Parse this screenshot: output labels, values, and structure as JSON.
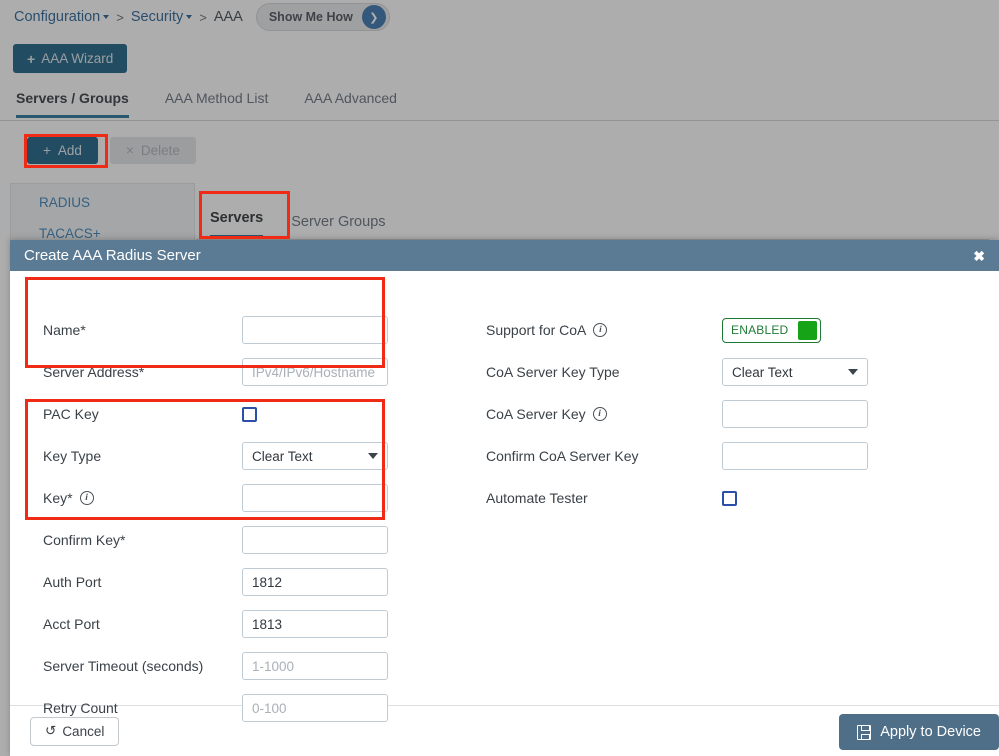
{
  "breadcrumb": {
    "items": [
      {
        "label": "Configuration",
        "has_caret": true,
        "link": true
      },
      {
        "label": "Security",
        "has_caret": true,
        "link": true
      },
      {
        "label": "AAA",
        "has_caret": false,
        "link": false
      }
    ],
    "separator": ">",
    "show_me_how": "Show Me How"
  },
  "toolbar": {
    "wizard_label": "AAA Wizard",
    "wizard_plus": "+",
    "add_label": "Add",
    "add_plus": "+",
    "delete_label": "Delete",
    "delete_x": "×"
  },
  "top_tabs": [
    {
      "label": "Servers / Groups",
      "active": true
    },
    {
      "label": "AAA Method List",
      "active": false
    },
    {
      "label": "AAA Advanced",
      "active": false
    }
  ],
  "side_panel": {
    "items": [
      {
        "label": "RADIUS"
      },
      {
        "label": "TACACS+"
      }
    ]
  },
  "inner_tabs": [
    {
      "label": "Servers",
      "active": true
    },
    {
      "label": "Server Groups",
      "active": false
    }
  ],
  "modal": {
    "title": "Create AAA Radius Server",
    "close_icon": "✖",
    "left_fields": [
      {
        "label": "Name*",
        "type": "text",
        "value": "",
        "placeholder": ""
      },
      {
        "label": "Server Address*",
        "type": "text",
        "value": "",
        "placeholder": "IPv4/IPv6/Hostname"
      },
      {
        "label": "PAC Key",
        "type": "checkbox",
        "checked": false
      },
      {
        "label": "Key Type",
        "type": "select",
        "value": "Clear Text"
      },
      {
        "label": "Key*",
        "type": "text",
        "value": "",
        "placeholder": "",
        "info": true
      },
      {
        "label": "Confirm Key*",
        "type": "text",
        "value": "",
        "placeholder": ""
      },
      {
        "label": "Auth Port",
        "type": "text",
        "value": "1812",
        "placeholder": ""
      },
      {
        "label": "Acct Port",
        "type": "text",
        "value": "1813",
        "placeholder": ""
      },
      {
        "label": "Server Timeout (seconds)",
        "type": "text",
        "value": "",
        "placeholder": "1-1000"
      },
      {
        "label": "Retry Count",
        "type": "text",
        "value": "",
        "placeholder": "0-100"
      }
    ],
    "right_fields": [
      {
        "label": "Support for CoA",
        "type": "toggle",
        "value": "ENABLED",
        "info": true
      },
      {
        "label": "CoA Server Key Type",
        "type": "select",
        "value": "Clear Text"
      },
      {
        "label": "CoA Server Key",
        "type": "text",
        "value": "",
        "placeholder": "",
        "info": true
      },
      {
        "label": "Confirm CoA Server Key",
        "type": "text",
        "value": "",
        "placeholder": ""
      },
      {
        "label": "Automate Tester",
        "type": "checkbox",
        "checked": false
      }
    ],
    "footer": {
      "cancel_label": "Cancel",
      "cancel_icon": "↺",
      "apply_label": "Apply to Device"
    }
  },
  "colors": {
    "accent_teal": "#10597f",
    "modal_header": "#5b7b95",
    "highlight_red": "#ef2b16",
    "toggle_green": "#16a317",
    "link_blue": "#1f5b91",
    "apply_button": "#4f6e88"
  }
}
